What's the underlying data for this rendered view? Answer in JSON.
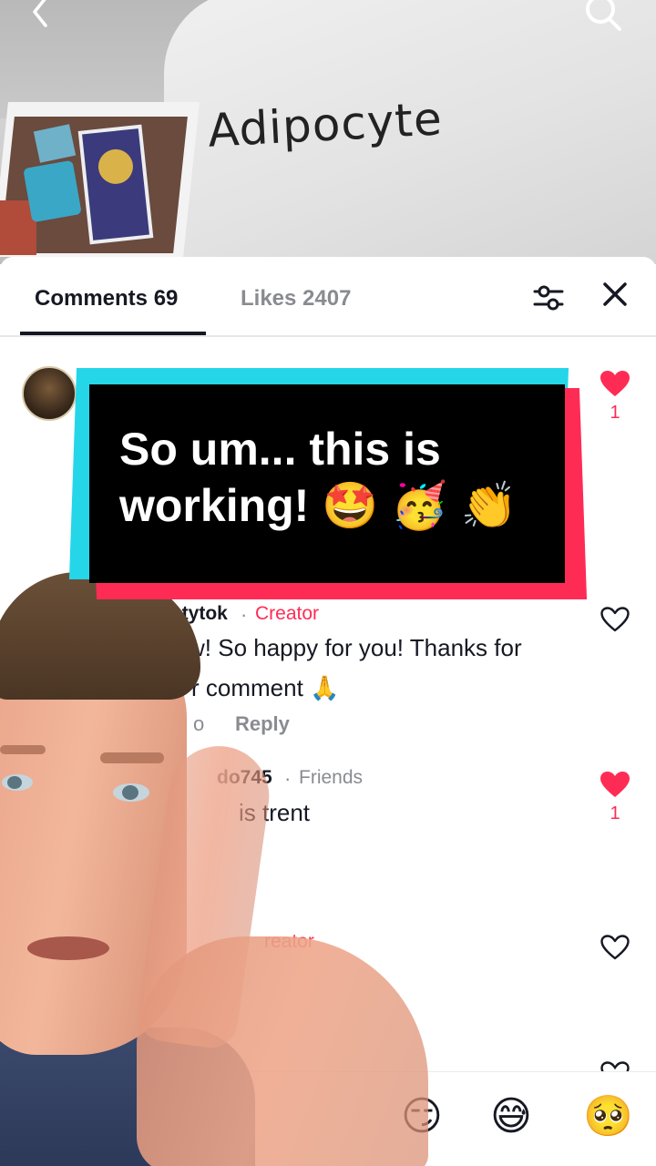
{
  "video": {
    "sign_text": "Adipocyte",
    "back_icon": "chevron-left-icon",
    "search_icon": "search-icon"
  },
  "tabs": {
    "comments_label": "Comments 69",
    "likes_label": "Likes 2407"
  },
  "overlay_caption": {
    "line1": "So um... this is",
    "line2": "working! 🤩 🥳 👏"
  },
  "comments": [
    {
      "likes": "1",
      "liked": true
    },
    {
      "username": "trentytok",
      "tag": "Creator",
      "text_line1": "w! So happy for you! Thanks for",
      "text_line2": "r comment 🙏",
      "meta": "o",
      "reply_label": "Reply",
      "liked": false
    },
    {
      "username": "do745",
      "tag": "Friends",
      "text": "is trent",
      "likes": "1",
      "liked": true
    },
    {
      "tag": "reator",
      "liked": false
    }
  ],
  "emoji_bar": {
    "emojis": [
      "😏",
      "😅",
      "🥺"
    ]
  },
  "colors": {
    "accent_red": "#fe2c55",
    "accent_cyan": "#25d6e8",
    "text_primary": "#161823",
    "text_secondary": "#8a8b91"
  }
}
